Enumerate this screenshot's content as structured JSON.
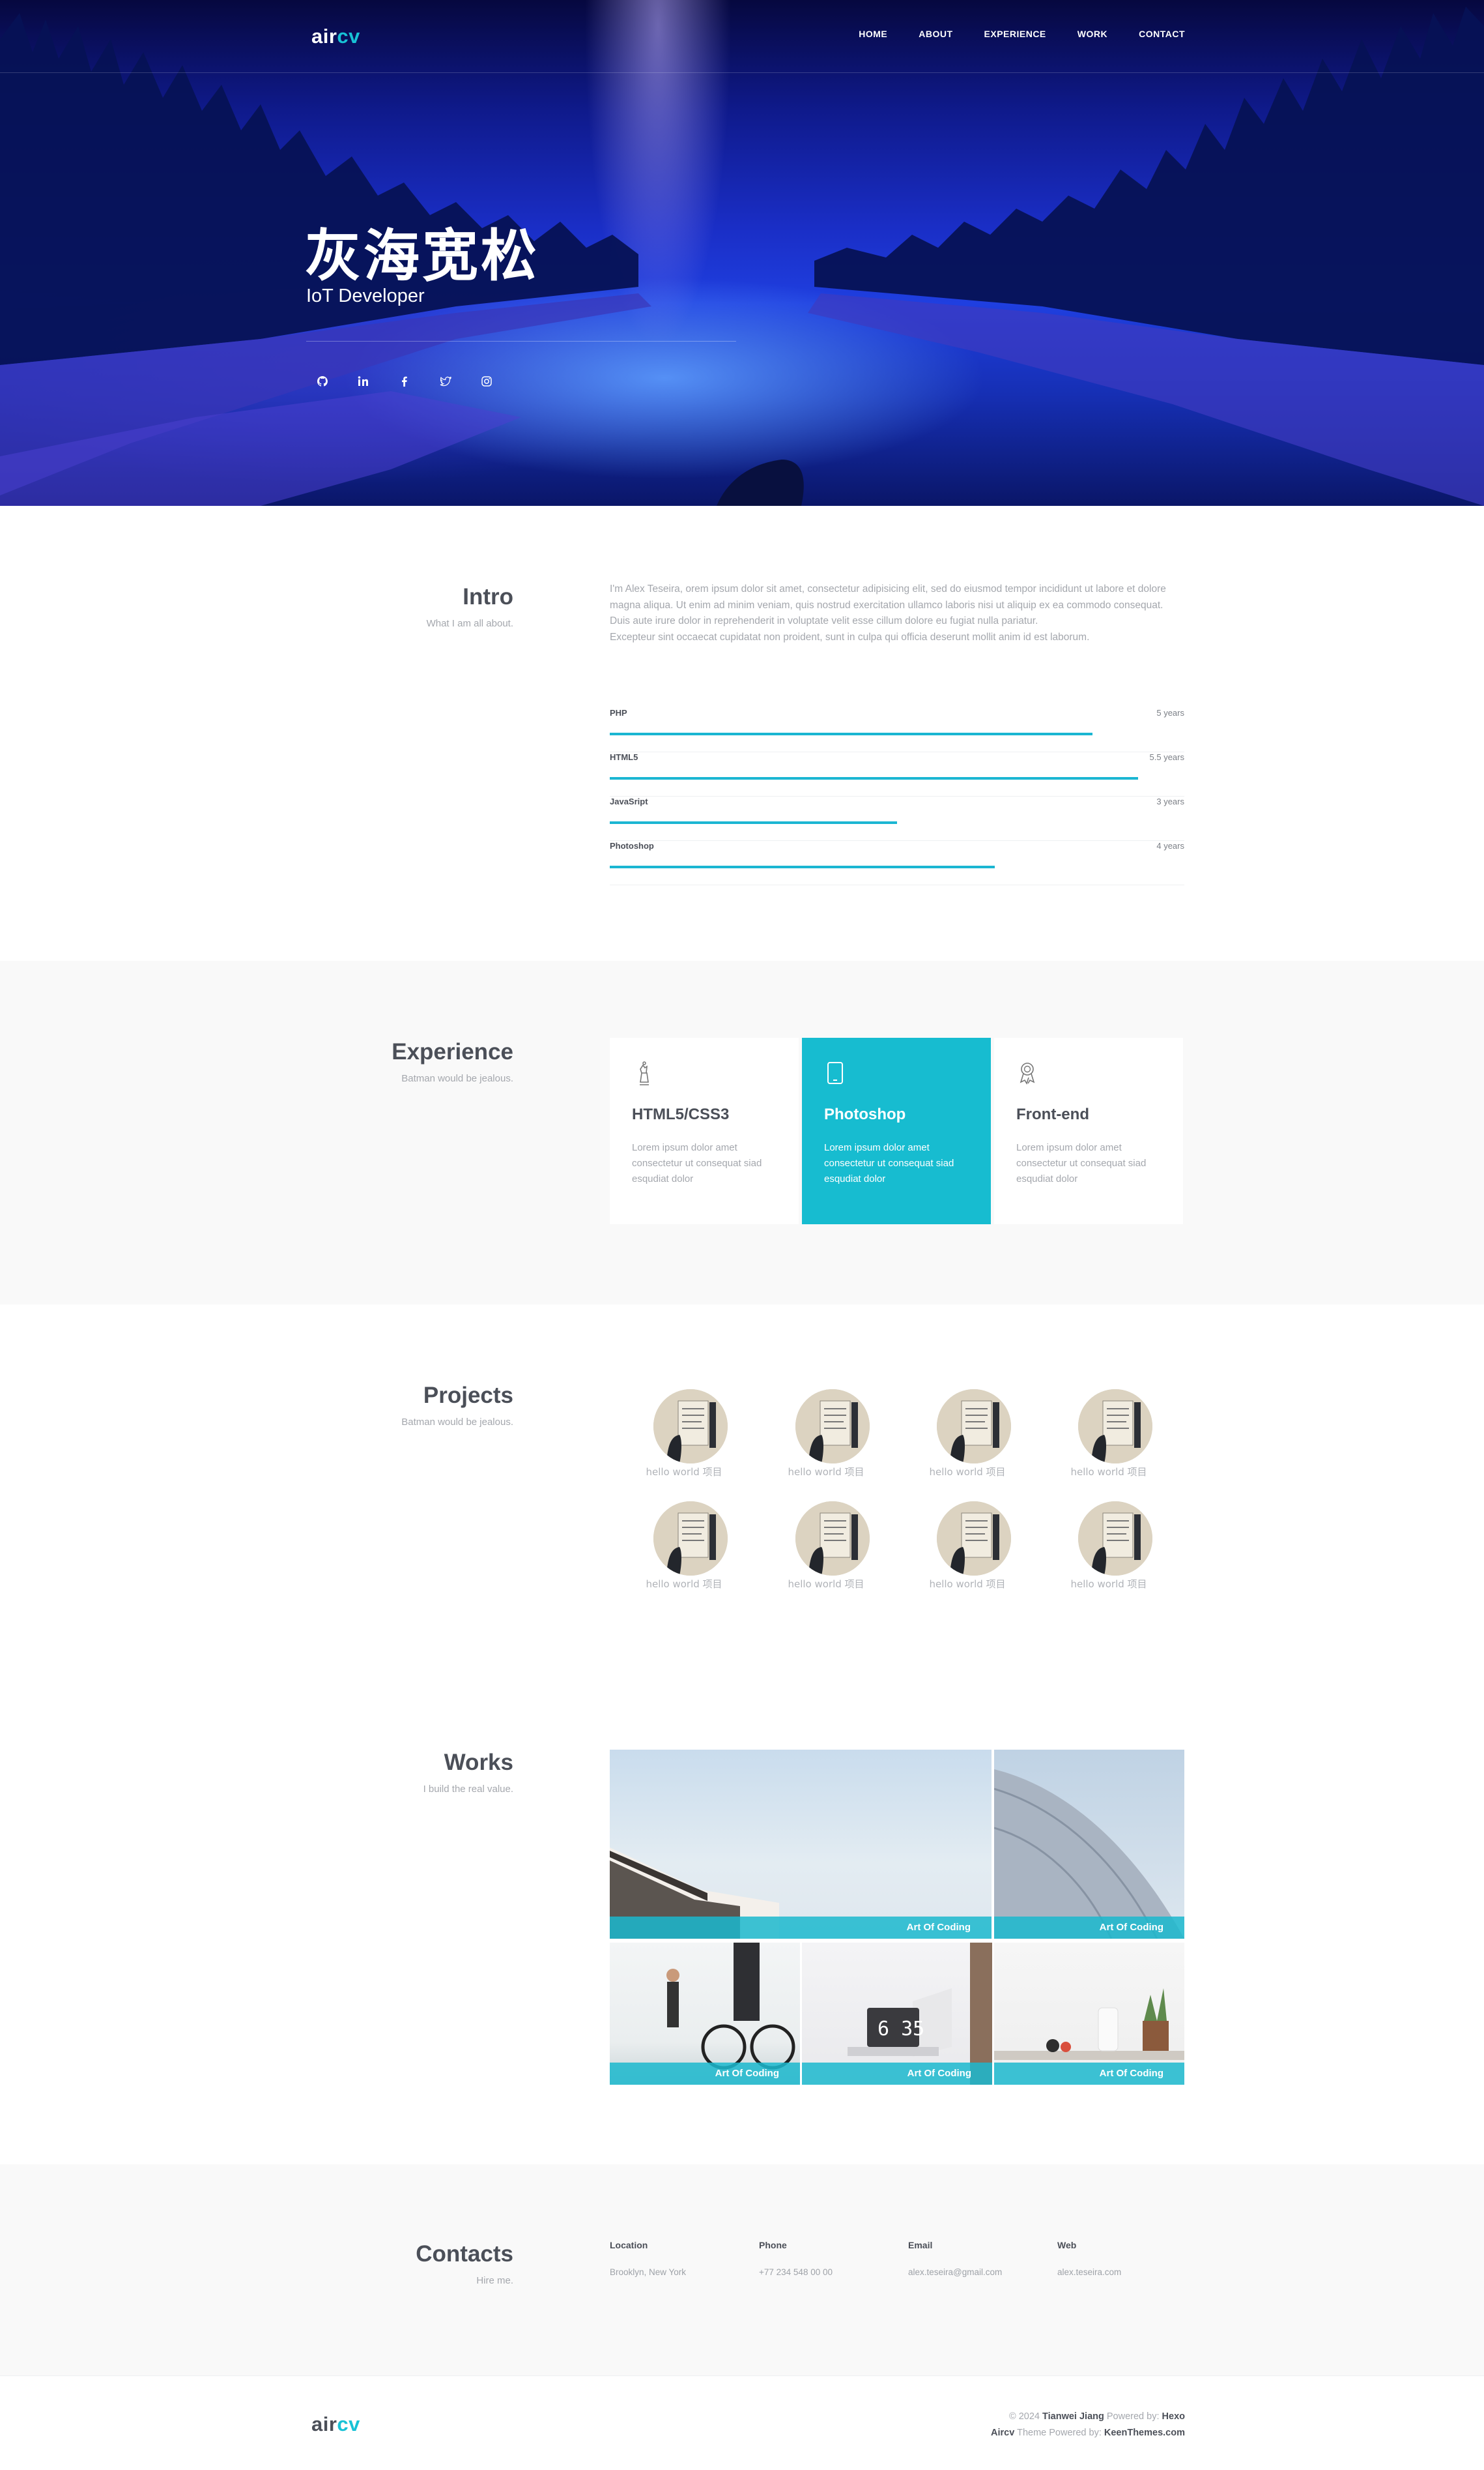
{
  "site": {
    "logo_a": "air",
    "logo_b": "cv"
  },
  "nav": {
    "items": [
      "HOME",
      "ABOUT",
      "EXPERIENCE",
      "WORK",
      "CONTACT"
    ]
  },
  "hero": {
    "name": "灰海宽松",
    "role": "IoT Developer",
    "social": [
      "github-icon",
      "linkedin-icon",
      "facebook-icon",
      "twitter-icon",
      "instagram-icon"
    ]
  },
  "intro": {
    "title": "Intro",
    "subtitle": "What I am all about.",
    "paragraph": "I'm Alex Teseira, orem ipsum dolor sit amet, consectetur adipisicing elit, sed do eiusmod tempor incididunt ut labore et dolore magna aliqua. Ut enim ad minim veniam, quis nostrud exercitation ullamco laboris nisi ut aliquip ex ea commodo consequat.\nDuis aute irure dolor in reprehenderit in voluptate velit esse cillum dolore eu fugiat nulla pariatur.\nExcepteur sint occaecat cupidatat non proident, sunt in culpa qui officia deserunt mollit anim id est laborum.",
    "skills": [
      {
        "name": "PHP",
        "years": "5 years",
        "level": 0.84
      },
      {
        "name": "HTML5",
        "years": "5.5 years",
        "level": 0.92
      },
      {
        "name": "JavaSript",
        "years": "3 years",
        "level": 0.5
      },
      {
        "name": "Photoshop",
        "years": "4 years",
        "level": 0.67
      }
    ]
  },
  "experience": {
    "title": "Experience",
    "subtitle": "Batman would be jealous.",
    "cards": [
      {
        "icon": "chess-piece-icon",
        "title": "HTML5/CSS3",
        "text": "Lorem ipsum dolor amet consectetur ut consequat siad esqudiat dolor"
      },
      {
        "icon": "tablet-icon",
        "title": "Photoshop",
        "text": "Lorem ipsum dolor amet consectetur ut consequat siad esqudiat dolor"
      },
      {
        "icon": "award-icon",
        "title": "Front-end",
        "text": "Lorem ipsum dolor amet consectetur ut consequat siad esqudiat dolor"
      }
    ]
  },
  "projects": {
    "title": "Projects",
    "subtitle": "Batman would be jealous.",
    "items": [
      "hello world 项目",
      "hello world 项目",
      "hello world 项目",
      "hello world 项目",
      "hello world 项目",
      "hello world 项目",
      "hello world 项目",
      "hello world 项目"
    ]
  },
  "works": {
    "title": "Works",
    "subtitle": "I build the real value.",
    "items": [
      "Art Of Coding",
      "Art Of Coding",
      "Art Of Coding",
      "Art Of Coding",
      "Art Of Coding"
    ]
  },
  "contacts": {
    "title": "Contacts",
    "subtitle": "Hire me.",
    "items": [
      {
        "label": "Location",
        "value": "Brooklyn, New York"
      },
      {
        "label": "Phone",
        "value": "+77 234 548 00 00"
      },
      {
        "label": "Email",
        "value": "alex.teseira@gmail.com"
      },
      {
        "label": "Web",
        "value": "alex.teseira.com"
      }
    ]
  },
  "footer": {
    "copy_prefix": "© 2024",
    "author": "Tianwei Jiang",
    "powered_label": "Powered by:",
    "powered": "Hexo",
    "theme": "Aircv",
    "theme_label": "Theme Powered by:",
    "theme_by": "KeenThemes.com"
  },
  "colors": {
    "accent": "#17bcd0",
    "text": "#4b4f58",
    "muted": "#a4a7ad"
  }
}
